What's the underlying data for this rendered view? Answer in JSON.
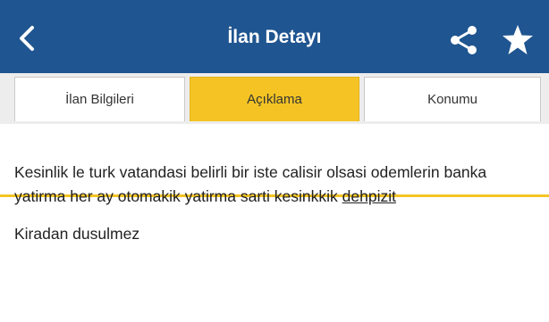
{
  "header": {
    "title": "İlan Detayı",
    "bar_color": "#1f5590",
    "icons": [
      "chevron-left-icon",
      "share-icon",
      "star-icon"
    ]
  },
  "tabs": [
    {
      "label": "İlan Bilgileri",
      "active": false
    },
    {
      "label": "Açıklama",
      "active": true
    },
    {
      "label": "Konumu",
      "active": false
    }
  ],
  "accent_color": "#f5c424",
  "content": {
    "description_text": "Kesinlik le turk vatandasi belirli bir iste calisir olsasi odemlerin banka yatirma her ay otomakik yatirma sarti kesinkkik ",
    "description_link": "dehpizit",
    "note": "Kiradan dusulmez"
  }
}
